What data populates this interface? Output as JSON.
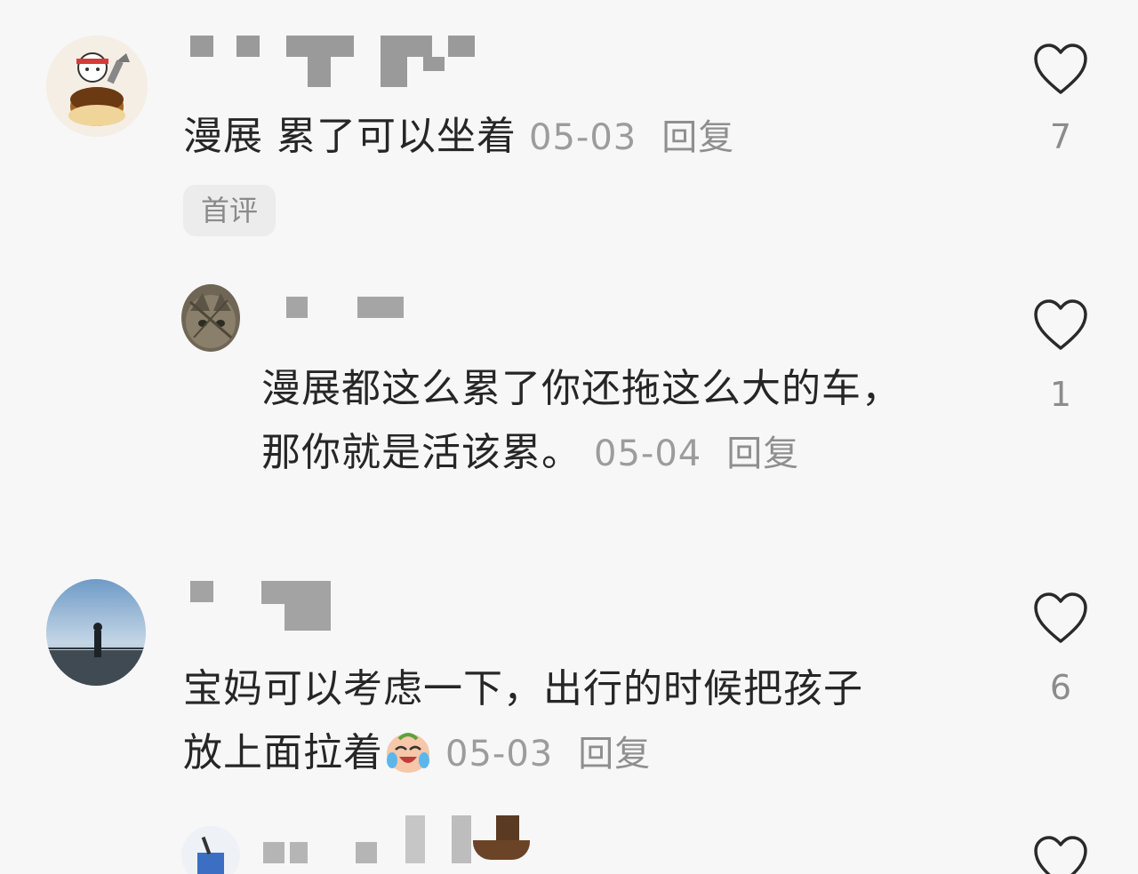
{
  "comments": [
    {
      "text": "漫展 累了可以坐着",
      "date": "05-03",
      "reply_label": "回复",
      "likes": "7",
      "badge": "首评"
    },
    {
      "text_line1": "漫展都这么累了你还拖这么大的车，",
      "text_line2": "那你就是活该累。",
      "date": "05-04",
      "reply_label": "回复",
      "likes": "1"
    },
    {
      "text_line1": "宝妈可以考虑一下，出行的时候把孩子",
      "text_line2": "放上面拉着",
      "date": "05-03",
      "reply_label": "回复",
      "likes": "6",
      "emoji": "laughing-crying-face-icon"
    }
  ],
  "colors": {
    "background": "#f7f7f8",
    "text": "#262626",
    "meta": "#9c9c9c",
    "redaction": "#9a9a9a"
  }
}
